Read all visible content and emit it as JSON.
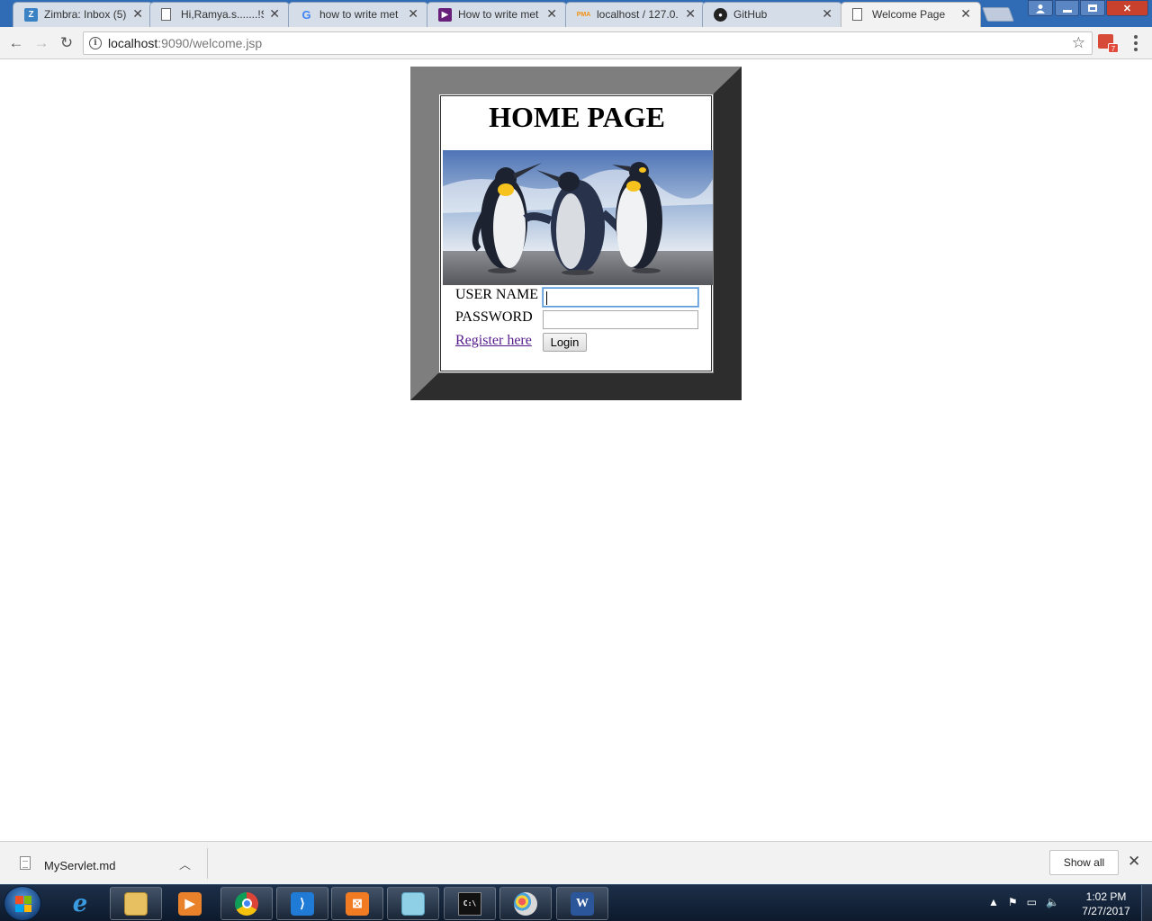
{
  "browser": {
    "tabs": [
      {
        "title": "Zimbra: Inbox (5)",
        "icon": "zimbra-icon"
      },
      {
        "title": "Hi,Ramya.s.......!Se",
        "icon": "page-icon"
      },
      {
        "title": "how to write met",
        "icon": "google-icon"
      },
      {
        "title": "How to write met",
        "icon": "visualstudio-icon"
      },
      {
        "title": "localhost / 127.0.",
        "icon": "phpmyadmin-icon"
      },
      {
        "title": "GitHub",
        "icon": "github-icon"
      },
      {
        "title": "Welcome Page",
        "icon": "page-icon",
        "active": true
      }
    ],
    "address": {
      "host": "localhost",
      "path": ":9090/welcome.jsp"
    },
    "extension_badge": "7"
  },
  "page": {
    "title": "HOME PAGE",
    "image_alt": "penguins",
    "form": {
      "username_label": "USER NAME",
      "password_label": "PASSWORD",
      "username_value": "",
      "password_value": "",
      "register_link": "Register here",
      "login_button": "Login"
    }
  },
  "downloads": {
    "file_name": "MyServlet.md",
    "show_all": "Show all"
  },
  "taskbar": {
    "time": "1:02 PM",
    "date": "7/27/2017",
    "apps": [
      "internet-explorer-icon",
      "file-explorer-icon",
      "media-player-icon",
      "chrome-icon",
      "visual-studio-code-icon",
      "xampp-icon",
      "notepad-icon",
      "command-prompt-icon",
      "paint-icon",
      "word-icon"
    ]
  },
  "colors": {
    "frame_light": "#7e7e7e",
    "frame_dark": "#2d2d2d",
    "link_visited": "#551a8b",
    "titlebar": "#2f6cb5"
  }
}
